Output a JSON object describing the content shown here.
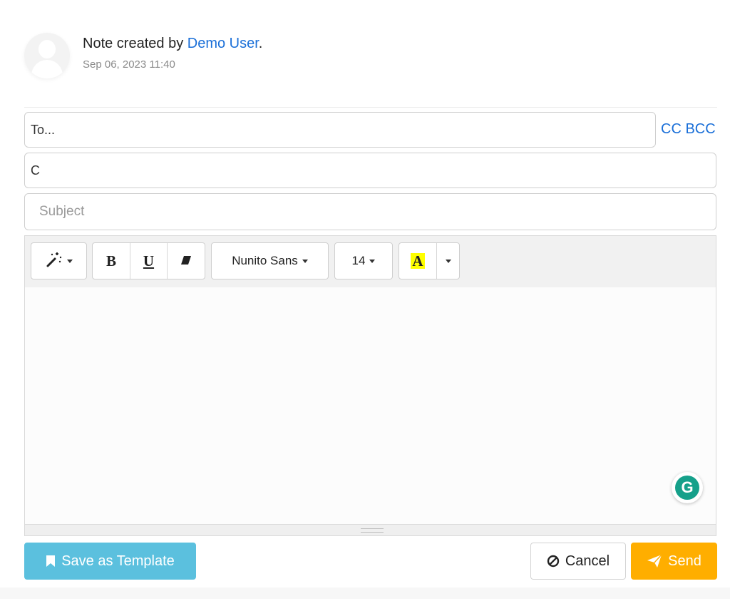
{
  "note": {
    "prefix": "Note created by ",
    "user": "Demo User",
    "suffix": ".",
    "timestamp": "Sep 06, 2023 11:40"
  },
  "compose": {
    "to_value": "To...",
    "cc_value": "C",
    "subject_placeholder": "Subject",
    "cc_label": "CC",
    "bcc_label": "BCC"
  },
  "toolbar": {
    "style_icon": "magic-wand-icon",
    "bold_label": "B",
    "underline_label": "U",
    "eraser_icon": "eraser-icon",
    "font_family": "Nunito Sans",
    "font_size": "14",
    "color_label": "A",
    "highlight_color": "#ffff00"
  },
  "grammarly": {
    "label": "G",
    "color": "#15a08a"
  },
  "actions": {
    "save_template": "Save as Template",
    "cancel": "Cancel",
    "send": "Send"
  },
  "colors": {
    "link": "#1a6fd8",
    "template_button": "#5bc0de",
    "send_button": "#ffae00"
  }
}
